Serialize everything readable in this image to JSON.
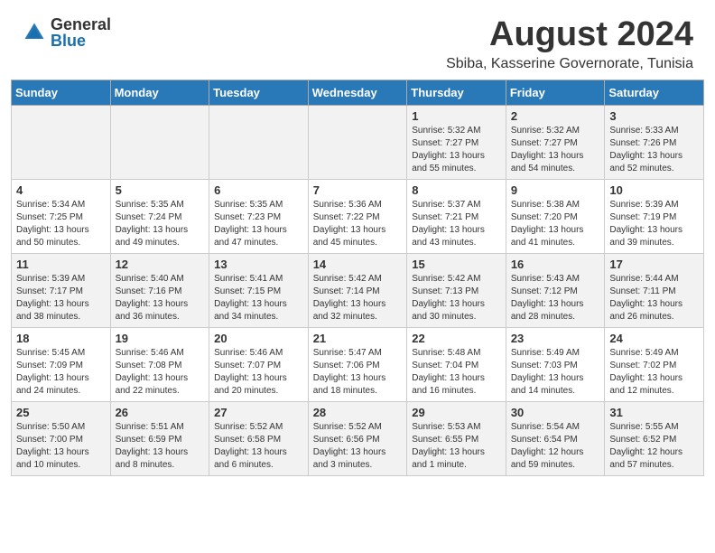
{
  "header": {
    "logo_general": "General",
    "logo_blue": "Blue",
    "month_year": "August 2024",
    "location": "Sbiba, Kasserine Governorate, Tunisia"
  },
  "days_of_week": [
    "Sunday",
    "Monday",
    "Tuesday",
    "Wednesday",
    "Thursday",
    "Friday",
    "Saturday"
  ],
  "weeks": [
    [
      {
        "day": "",
        "info": ""
      },
      {
        "day": "",
        "info": ""
      },
      {
        "day": "",
        "info": ""
      },
      {
        "day": "",
        "info": ""
      },
      {
        "day": "1",
        "info": "Sunrise: 5:32 AM\nSunset: 7:27 PM\nDaylight: 13 hours\nand 55 minutes."
      },
      {
        "day": "2",
        "info": "Sunrise: 5:32 AM\nSunset: 7:27 PM\nDaylight: 13 hours\nand 54 minutes."
      },
      {
        "day": "3",
        "info": "Sunrise: 5:33 AM\nSunset: 7:26 PM\nDaylight: 13 hours\nand 52 minutes."
      }
    ],
    [
      {
        "day": "4",
        "info": "Sunrise: 5:34 AM\nSunset: 7:25 PM\nDaylight: 13 hours\nand 50 minutes."
      },
      {
        "day": "5",
        "info": "Sunrise: 5:35 AM\nSunset: 7:24 PM\nDaylight: 13 hours\nand 49 minutes."
      },
      {
        "day": "6",
        "info": "Sunrise: 5:35 AM\nSunset: 7:23 PM\nDaylight: 13 hours\nand 47 minutes."
      },
      {
        "day": "7",
        "info": "Sunrise: 5:36 AM\nSunset: 7:22 PM\nDaylight: 13 hours\nand 45 minutes."
      },
      {
        "day": "8",
        "info": "Sunrise: 5:37 AM\nSunset: 7:21 PM\nDaylight: 13 hours\nand 43 minutes."
      },
      {
        "day": "9",
        "info": "Sunrise: 5:38 AM\nSunset: 7:20 PM\nDaylight: 13 hours\nand 41 minutes."
      },
      {
        "day": "10",
        "info": "Sunrise: 5:39 AM\nSunset: 7:19 PM\nDaylight: 13 hours\nand 39 minutes."
      }
    ],
    [
      {
        "day": "11",
        "info": "Sunrise: 5:39 AM\nSunset: 7:17 PM\nDaylight: 13 hours\nand 38 minutes."
      },
      {
        "day": "12",
        "info": "Sunrise: 5:40 AM\nSunset: 7:16 PM\nDaylight: 13 hours\nand 36 minutes."
      },
      {
        "day": "13",
        "info": "Sunrise: 5:41 AM\nSunset: 7:15 PM\nDaylight: 13 hours\nand 34 minutes."
      },
      {
        "day": "14",
        "info": "Sunrise: 5:42 AM\nSunset: 7:14 PM\nDaylight: 13 hours\nand 32 minutes."
      },
      {
        "day": "15",
        "info": "Sunrise: 5:42 AM\nSunset: 7:13 PM\nDaylight: 13 hours\nand 30 minutes."
      },
      {
        "day": "16",
        "info": "Sunrise: 5:43 AM\nSunset: 7:12 PM\nDaylight: 13 hours\nand 28 minutes."
      },
      {
        "day": "17",
        "info": "Sunrise: 5:44 AM\nSunset: 7:11 PM\nDaylight: 13 hours\nand 26 minutes."
      }
    ],
    [
      {
        "day": "18",
        "info": "Sunrise: 5:45 AM\nSunset: 7:09 PM\nDaylight: 13 hours\nand 24 minutes."
      },
      {
        "day": "19",
        "info": "Sunrise: 5:46 AM\nSunset: 7:08 PM\nDaylight: 13 hours\nand 22 minutes."
      },
      {
        "day": "20",
        "info": "Sunrise: 5:46 AM\nSunset: 7:07 PM\nDaylight: 13 hours\nand 20 minutes."
      },
      {
        "day": "21",
        "info": "Sunrise: 5:47 AM\nSunset: 7:06 PM\nDaylight: 13 hours\nand 18 minutes."
      },
      {
        "day": "22",
        "info": "Sunrise: 5:48 AM\nSunset: 7:04 PM\nDaylight: 13 hours\nand 16 minutes."
      },
      {
        "day": "23",
        "info": "Sunrise: 5:49 AM\nSunset: 7:03 PM\nDaylight: 13 hours\nand 14 minutes."
      },
      {
        "day": "24",
        "info": "Sunrise: 5:49 AM\nSunset: 7:02 PM\nDaylight: 13 hours\nand 12 minutes."
      }
    ],
    [
      {
        "day": "25",
        "info": "Sunrise: 5:50 AM\nSunset: 7:00 PM\nDaylight: 13 hours\nand 10 minutes."
      },
      {
        "day": "26",
        "info": "Sunrise: 5:51 AM\nSunset: 6:59 PM\nDaylight: 13 hours\nand 8 minutes."
      },
      {
        "day": "27",
        "info": "Sunrise: 5:52 AM\nSunset: 6:58 PM\nDaylight: 13 hours\nand 6 minutes."
      },
      {
        "day": "28",
        "info": "Sunrise: 5:52 AM\nSunset: 6:56 PM\nDaylight: 13 hours\nand 3 minutes."
      },
      {
        "day": "29",
        "info": "Sunrise: 5:53 AM\nSunset: 6:55 PM\nDaylight: 13 hours\nand 1 minute."
      },
      {
        "day": "30",
        "info": "Sunrise: 5:54 AM\nSunset: 6:54 PM\nDaylight: 12 hours\nand 59 minutes."
      },
      {
        "day": "31",
        "info": "Sunrise: 5:55 AM\nSunset: 6:52 PM\nDaylight: 12 hours\nand 57 minutes."
      }
    ]
  ]
}
